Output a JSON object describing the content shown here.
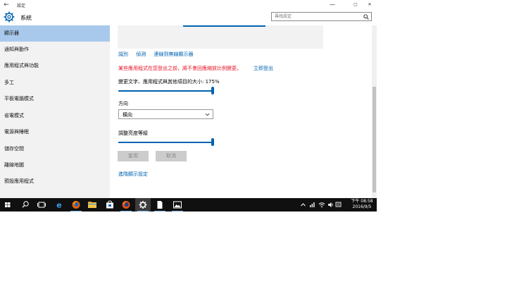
{
  "window": {
    "title": "設定",
    "controls": {
      "minimize": "—",
      "maximize": "▢",
      "close": "✕"
    }
  },
  "header": {
    "title": "系統"
  },
  "search": {
    "placeholder": "尋找設定"
  },
  "sidebar": {
    "items": [
      {
        "label": "顯示器",
        "active": true
      },
      {
        "label": "通知與動作"
      },
      {
        "label": "應用程式與功能"
      },
      {
        "label": "多工"
      },
      {
        "label": "平板電腦模式"
      },
      {
        "label": "省電模式"
      },
      {
        "label": "電源與睡眠"
      },
      {
        "label": "儲存空間"
      },
      {
        "label": "離線地圖"
      },
      {
        "label": "預設應用程式"
      }
    ]
  },
  "display": {
    "links": [
      "識別",
      "偵測",
      "連線到無線顯示器"
    ],
    "warning": "某些應用程式在您登出之前，將不會回應縮放比例變更。",
    "signout": "立即登出",
    "scale_label": "變更文字、應用程式與其他項目的大小: 175%",
    "scale_percent": 175,
    "orientation_label": "方向",
    "orientation_value": "橫向",
    "brightness_label": "調整亮度等級",
    "apply": "套用",
    "cancel": "取消",
    "advanced": "進階顯示設定"
  },
  "taskbar": {
    "icons": [
      "start-icon",
      "search-icon",
      "task-view-icon",
      "edge-icon",
      "firefox-icon",
      "file-explorer-icon",
      "store-icon",
      "firefox-dev-icon",
      "settings-icon",
      "document-icon",
      "photos-icon"
    ],
    "tray": [
      "chevron-up-icon",
      "network-icon",
      "wifi-icon",
      "volume-icon",
      "notification-icon"
    ],
    "time": "下午 08:58",
    "date": "2016/9/5"
  },
  "colors": {
    "accent": "#0063b1",
    "warning": "#e81123",
    "selected": "#a9c9ec",
    "taskbar": "#101010"
  }
}
